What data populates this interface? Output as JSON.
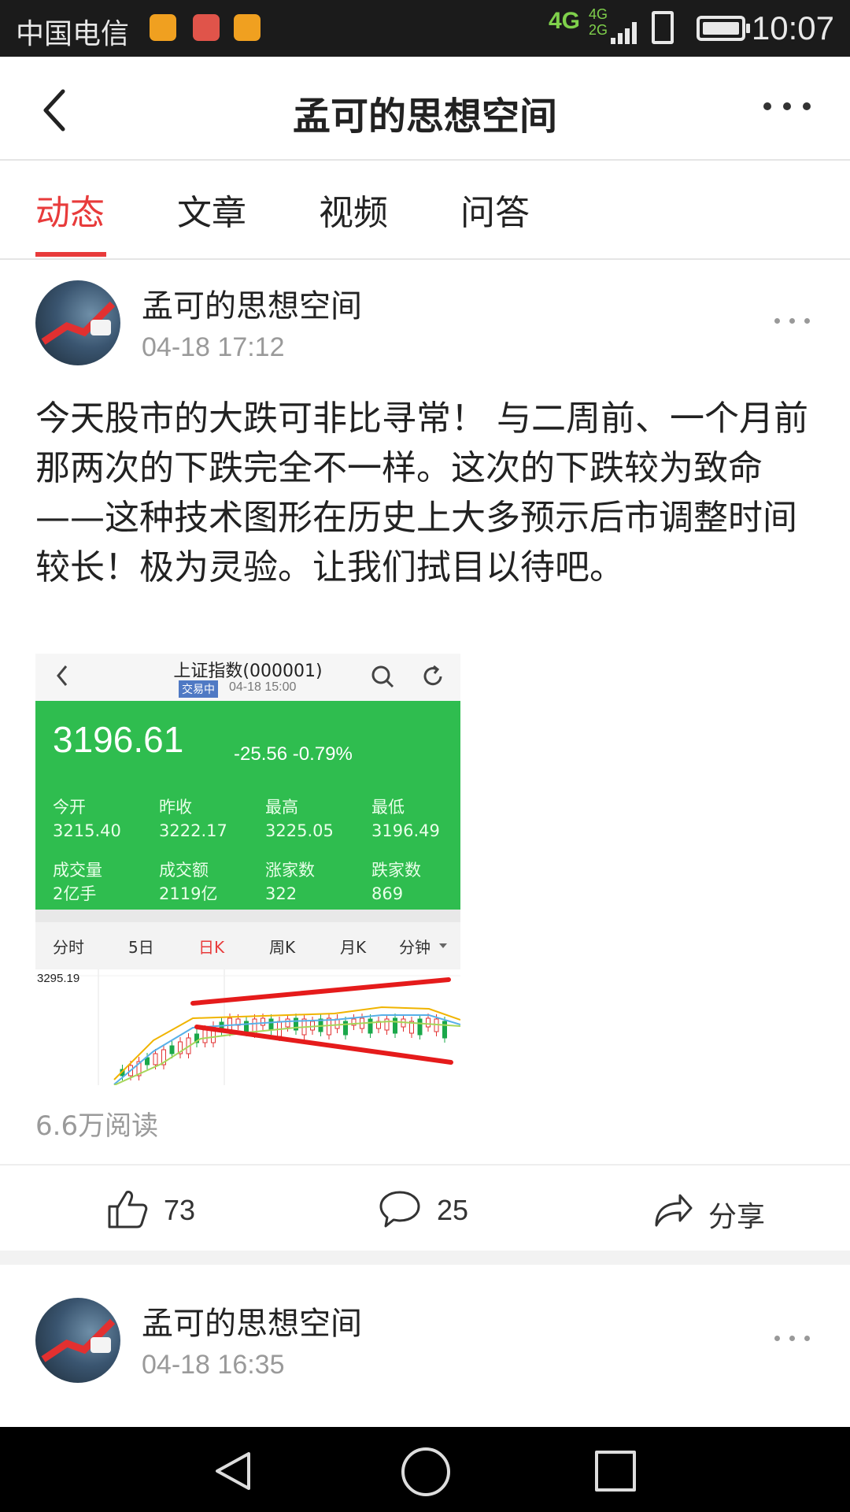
{
  "status_bar": {
    "carrier": "中国电信",
    "network": "4G",
    "network_secondary": [
      "4G",
      "2G"
    ],
    "time": "10:07"
  },
  "header": {
    "title": "孟可的思想空间"
  },
  "tabs": [
    {
      "label": "动态",
      "active": true
    },
    {
      "label": "文章",
      "active": false
    },
    {
      "label": "视频",
      "active": false
    },
    {
      "label": "问答",
      "active": false
    }
  ],
  "posts": [
    {
      "author": "孟可的思想空间",
      "time": "04-18 17:12",
      "text": "今天股市的大跌可非比寻常！ 与二周前、一个月前那两次的下跌完全不一样。这次的下跌较为致命——这种技术图形在历史上大多预示后市调整时间较长！极为灵验。让我们拭目以待吧。",
      "image": {
        "title": "上证指数(000001)",
        "badge": "交易中",
        "datetime": "04-18 15:00",
        "price": "3196.61",
        "change": "-25.56",
        "change_pct": "-0.79%",
        "stats": [
          {
            "label": "今开",
            "value": "3215.40"
          },
          {
            "label": "昨收",
            "value": "3222.17"
          },
          {
            "label": "最高",
            "value": "3225.05"
          },
          {
            "label": "最低",
            "value": "3196.49"
          },
          {
            "label": "成交量",
            "value": "2亿手"
          },
          {
            "label": "成交额",
            "value": "2119亿"
          },
          {
            "label": "涨家数",
            "value": "322"
          },
          {
            "label": "跌家数",
            "value": "869"
          }
        ],
        "chart_tabs": [
          "分时",
          "5日",
          "日K",
          "周K",
          "月K",
          "分钟"
        ],
        "active_chart_tab": "日K",
        "chart_high_label": "3295.19"
      },
      "reads": "6.6万阅读",
      "likes": "73",
      "comments": "25",
      "share_label": "分享"
    },
    {
      "author": "孟可的思想空间",
      "time": "04-18 16:35"
    }
  ],
  "colors": {
    "accent": "#e83b3b",
    "stock_green": "#2fbd4f"
  }
}
